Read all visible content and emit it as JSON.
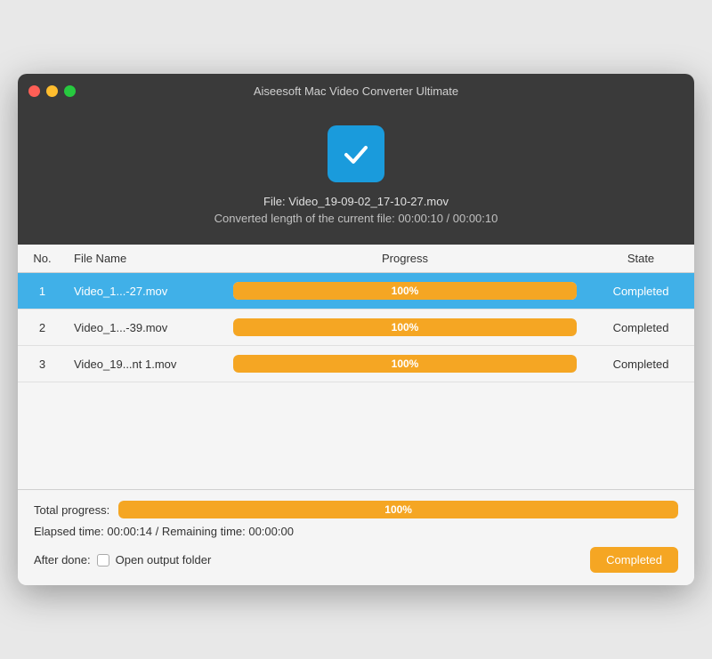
{
  "window": {
    "title": "Aiseesoft Mac Video Converter Ultimate"
  },
  "header": {
    "file_info": "File: Video_19-09-02_17-10-27.mov",
    "converted_info": "Converted length of the current file: 00:00:10 / 00:00:10",
    "check_icon": "checkmark"
  },
  "table": {
    "columns": [
      "No.",
      "File Name",
      "Progress",
      "State"
    ],
    "rows": [
      {
        "no": "1",
        "name": "Video_1...-27.mov",
        "progress": 100,
        "state": "Completed",
        "selected": true
      },
      {
        "no": "2",
        "name": "Video_1...-39.mov",
        "progress": 100,
        "state": "Completed",
        "selected": false
      },
      {
        "no": "3",
        "name": "Video_19...nt 1.mov",
        "progress": 100,
        "state": "Completed",
        "selected": false
      }
    ]
  },
  "footer": {
    "total_label": "Total progress:",
    "total_percent": "100%",
    "elapsed": "Elapsed time: 00:00:14 / Remaining time: 00:00:00",
    "after_done_label": "After done:",
    "open_output_label": "Open output folder",
    "completed_button": "Completed"
  }
}
